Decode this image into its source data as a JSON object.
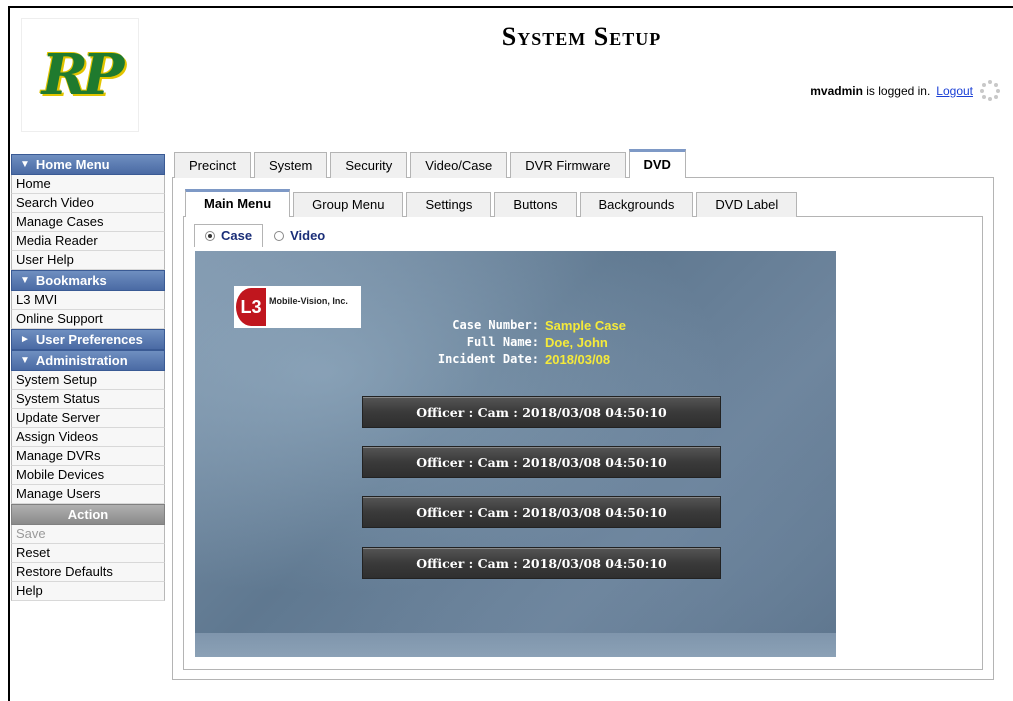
{
  "header": {
    "logo_text": "RP",
    "title": "System Setup",
    "user": "mvadmin",
    "logged_in_text": "is logged in.",
    "logout_label": "Logout"
  },
  "sidebar": {
    "home_menu": {
      "label": "Home Menu",
      "items": [
        "Home",
        "Search Video",
        "Manage Cases",
        "Media Reader",
        "User Help"
      ]
    },
    "bookmarks": {
      "label": "Bookmarks",
      "items": [
        "L3 MVI",
        "Online Support"
      ]
    },
    "user_preferences": {
      "label": "User Preferences"
    },
    "administration": {
      "label": "Administration",
      "items": [
        "System Setup",
        "System Status",
        "Update Server",
        "Assign Videos",
        "Manage DVRs",
        "Mobile Devices",
        "Manage Users"
      ]
    },
    "action": {
      "label": "Action",
      "items": [
        "Save",
        "Reset",
        "Restore Defaults",
        "Help"
      ]
    }
  },
  "tabs_primary": [
    "Precinct",
    "System",
    "Security",
    "Video/Case",
    "DVR Firmware",
    "DVD"
  ],
  "tabs_secondary": [
    "Main Menu",
    "Group Menu",
    "Settings",
    "Buttons",
    "Backgrounds",
    "DVD Label"
  ],
  "tabs_mode": [
    "Case",
    "Video"
  ],
  "preview": {
    "logo_mark": "L3",
    "logo_name": "Mobile-Vision, Inc.",
    "case_number_label": "Case Number:",
    "case_number": "Sample Case",
    "full_name_label": "Full Name:",
    "full_name": "Doe, John",
    "incident_date_label": "Incident Date:",
    "incident_date": "2018/03/08",
    "buttons": [
      "Officer : Cam : 2018/03/08 04:50:10",
      "Officer : Cam : 2018/03/08 04:50:10",
      "Officer : Cam : 2018/03/08 04:50:10",
      "Officer : Cam : 2018/03/08 04:50:10"
    ]
  },
  "colors": {
    "menu_header": "#5b7bb4",
    "info_value": "#f5ea3a",
    "link": "#1a3fd6",
    "logo_green": "#1f7a2e",
    "logo_yellow": "#e2c400"
  }
}
